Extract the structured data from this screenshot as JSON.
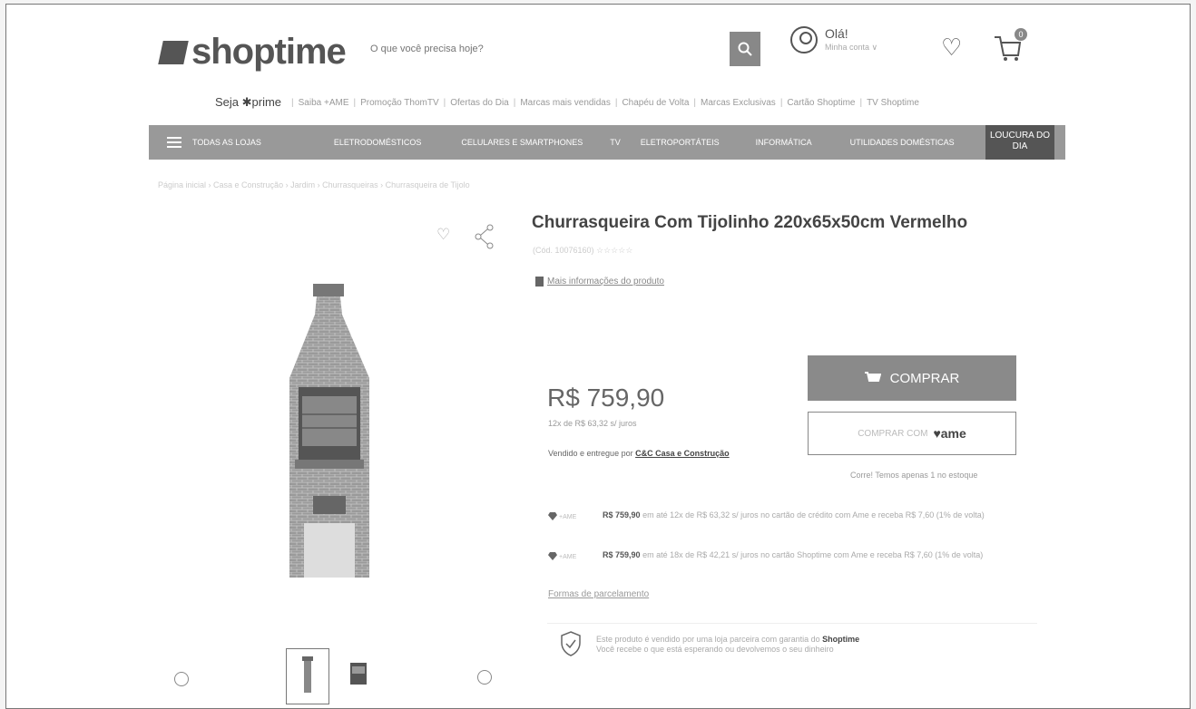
{
  "header": {
    "logo_text": "shoptime",
    "search_placeholder": "O que você precisa hoje?",
    "greeting": "Olá!",
    "account_label": "Minha conta ∨",
    "cart_count": "0"
  },
  "subnav": {
    "prime_label": "Seja ✱prime",
    "links": [
      "Saiba +AME",
      "Promoção ThomTV",
      "Ofertas do Dia",
      "Marcas mais vendidas",
      "Chapéu de Volta",
      "Marcas Exclusivas",
      "Cartão Shoptime",
      "TV Shoptime"
    ]
  },
  "mainnav": {
    "items": [
      "TODAS AS LOJAS",
      "ELETRODOMÉSTICOS",
      "CELULARES E SMARTPHONES",
      "TV",
      "ELETROPORTÁTEIS",
      "INFORMÁTICA",
      "UTILIDADES DOMÉSTICAS"
    ],
    "promo": "LOUCURA DO DIA"
  },
  "breadcrumb": "Página inicial  ›  Casa e Construção  ›  Jardim  ›  Churrasqueiras  ›  Churrasqueira de Tijolo",
  "product": {
    "title": "Churrasqueira Com Tijolinho 220x65x50cm Vermelho",
    "code": "(Cód. 10076160)  ☆☆☆☆☆",
    "more_info": "Mais informações do produto",
    "price": "R$ 759,90",
    "installments": "12x de R$ 63,32 s/ juros",
    "seller_prefix": "Vendido e entregue por",
    "seller_name": "C&C Casa e Construção",
    "buy_label": "COMPRAR",
    "ame_label": "COMPRAR COM",
    "ame_brand": "ame",
    "stock": "Corre! Temos apenas 1 no estoque",
    "ame_offers": [
      {
        "tag": "+AME",
        "price": "R$ 759,90",
        "text": "em até 12x de R$ 63,32 s/ juros no cartão de crédito com Ame e receba R$ 7,60 (1% de volta)"
      },
      {
        "tag": "+AME",
        "price": "R$ 759,90",
        "text": "em até 18x de R$ 42,21 s/ juros no cartão Shoptime com Ame e receba R$ 7,60 (1% de volta)"
      }
    ],
    "payment_forms": "Formas de parcelamento",
    "guarantee_line1_prefix": "Este produto é vendido por uma loja parceira com garantia do",
    "guarantee_brand": "Shoptime",
    "guarantee_line2": "Você recebe o que está esperando ou devolvemos o seu dinheiro"
  },
  "colors": {
    "nav_bg": "#999999",
    "buy_button": "#8a8a8a",
    "promo_bg": "#555555"
  }
}
